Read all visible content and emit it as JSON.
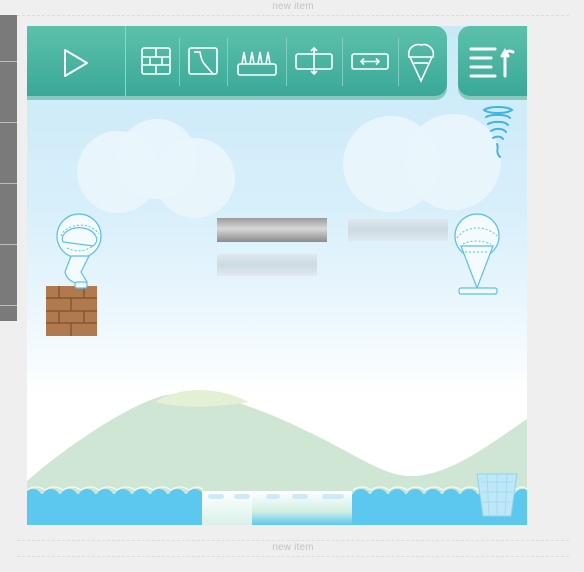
{
  "separators": {
    "top_label": "new item",
    "bottom_label": "new item"
  },
  "toolbar": {
    "play": {
      "icon": "play-icon"
    },
    "tools": [
      {
        "name": "tool-wall",
        "icon": "brick-wall-icon"
      },
      {
        "name": "tool-slope",
        "icon": "slope-icon"
      },
      {
        "name": "tool-spikes",
        "icon": "spikes-icon"
      },
      {
        "name": "tool-vertical-platform",
        "icon": "vertical-move-icon"
      },
      {
        "name": "tool-horizontal-platform",
        "icon": "horizontal-move-icon"
      },
      {
        "name": "tool-icecream",
        "icon": "ice-cream-icon"
      }
    ],
    "menu": {
      "icon": "menu-back-icon"
    }
  },
  "colors": {
    "toolbar": "#4fb9a3",
    "sky": "#cdebf8",
    "water": "#5cc8ef",
    "brick": "#b07a4e"
  }
}
